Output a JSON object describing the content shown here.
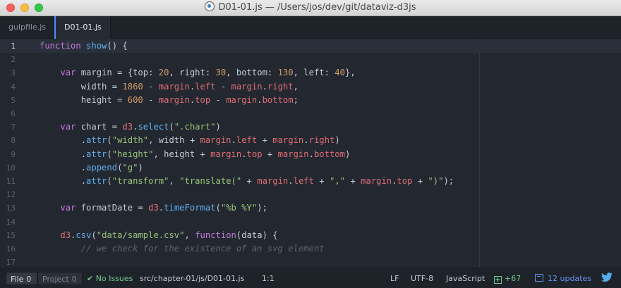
{
  "window": {
    "title": "D01-01.js — /Users/jos/dev/git/dataviz-d3js"
  },
  "tabs": [
    {
      "label": "gulpfile.js",
      "active": false
    },
    {
      "label": "D01-01.js",
      "active": true
    }
  ],
  "editor": {
    "current_line": 1,
    "lines": [
      {
        "num": "1",
        "tokens": [
          [
            "kw",
            "function"
          ],
          [
            "op",
            " "
          ],
          [
            "fn",
            "show"
          ],
          [
            "op",
            "() {"
          ]
        ]
      },
      {
        "num": "2",
        "tokens": []
      },
      {
        "num": "3",
        "tokens": [
          [
            "op",
            "    "
          ],
          [
            "kw",
            "var"
          ],
          [
            "op",
            " margin = {top: "
          ],
          [
            "num",
            "20"
          ],
          [
            "op",
            ", right: "
          ],
          [
            "num",
            "30"
          ],
          [
            "op",
            ", bottom: "
          ],
          [
            "num",
            "130"
          ],
          [
            "op",
            ", left: "
          ],
          [
            "num",
            "40"
          ],
          [
            "op",
            "},"
          ]
        ]
      },
      {
        "num": "4",
        "tokens": [
          [
            "op",
            "        width = "
          ],
          [
            "num",
            "1860"
          ],
          [
            "op",
            " - "
          ],
          [
            "prop",
            "margin"
          ],
          [
            "op",
            "."
          ],
          [
            "prop",
            "left"
          ],
          [
            "op",
            " - "
          ],
          [
            "prop",
            "margin"
          ],
          [
            "op",
            "."
          ],
          [
            "prop",
            "right"
          ],
          [
            "op",
            ","
          ]
        ]
      },
      {
        "num": "5",
        "tokens": [
          [
            "op",
            "        height = "
          ],
          [
            "num",
            "600"
          ],
          [
            "op",
            " - "
          ],
          [
            "prop",
            "margin"
          ],
          [
            "op",
            "."
          ],
          [
            "prop",
            "top"
          ],
          [
            "op",
            " - "
          ],
          [
            "prop",
            "margin"
          ],
          [
            "op",
            "."
          ],
          [
            "prop",
            "bottom"
          ],
          [
            "op",
            ";"
          ]
        ]
      },
      {
        "num": "6",
        "tokens": []
      },
      {
        "num": "7",
        "tokens": [
          [
            "op",
            "    "
          ],
          [
            "kw",
            "var"
          ],
          [
            "op",
            " chart = "
          ],
          [
            "prop",
            "d3"
          ],
          [
            "op",
            "."
          ],
          [
            "fn",
            "select"
          ],
          [
            "op",
            "("
          ],
          [
            "str",
            "\".chart\""
          ],
          [
            "op",
            ")"
          ]
        ]
      },
      {
        "num": "8",
        "tokens": [
          [
            "op",
            "        ."
          ],
          [
            "fn",
            "attr"
          ],
          [
            "op",
            "("
          ],
          [
            "str",
            "\"width\""
          ],
          [
            "op",
            ", width + "
          ],
          [
            "prop",
            "margin"
          ],
          [
            "op",
            "."
          ],
          [
            "prop",
            "left"
          ],
          [
            "op",
            " + "
          ],
          [
            "prop",
            "margin"
          ],
          [
            "op",
            "."
          ],
          [
            "prop",
            "right"
          ],
          [
            "op",
            ")"
          ]
        ]
      },
      {
        "num": "9",
        "tokens": [
          [
            "op",
            "        ."
          ],
          [
            "fn",
            "attr"
          ],
          [
            "op",
            "("
          ],
          [
            "str",
            "\"height\""
          ],
          [
            "op",
            ", height + "
          ],
          [
            "prop",
            "margin"
          ],
          [
            "op",
            "."
          ],
          [
            "prop",
            "top"
          ],
          [
            "op",
            " + "
          ],
          [
            "prop",
            "margin"
          ],
          [
            "op",
            "."
          ],
          [
            "prop",
            "bottom"
          ],
          [
            "op",
            ")"
          ]
        ]
      },
      {
        "num": "10",
        "tokens": [
          [
            "op",
            "        ."
          ],
          [
            "fn",
            "append"
          ],
          [
            "op",
            "("
          ],
          [
            "str",
            "\"g\""
          ],
          [
            "op",
            ")"
          ]
        ]
      },
      {
        "num": "11",
        "tokens": [
          [
            "op",
            "        ."
          ],
          [
            "fn",
            "attr"
          ],
          [
            "op",
            "("
          ],
          [
            "str",
            "\"transform\""
          ],
          [
            "op",
            ", "
          ],
          [
            "str",
            "\"translate(\""
          ],
          [
            "op",
            " + "
          ],
          [
            "prop",
            "margin"
          ],
          [
            "op",
            "."
          ],
          [
            "prop",
            "left"
          ],
          [
            "op",
            " + "
          ],
          [
            "str",
            "\",\""
          ],
          [
            "op",
            " + "
          ],
          [
            "prop",
            "margin"
          ],
          [
            "op",
            "."
          ],
          [
            "prop",
            "top"
          ],
          [
            "op",
            " + "
          ],
          [
            "str",
            "\")\""
          ],
          [
            "op",
            ");"
          ]
        ]
      },
      {
        "num": "12",
        "tokens": []
      },
      {
        "num": "13",
        "tokens": [
          [
            "op",
            "    "
          ],
          [
            "kw",
            "var"
          ],
          [
            "op",
            " formatDate = "
          ],
          [
            "prop",
            "d3"
          ],
          [
            "op",
            "."
          ],
          [
            "fn",
            "timeFormat"
          ],
          [
            "op",
            "("
          ],
          [
            "str",
            "\"%b %Y\""
          ],
          [
            "op",
            ");"
          ]
        ]
      },
      {
        "num": "14",
        "tokens": []
      },
      {
        "num": "15",
        "tokens": [
          [
            "op",
            "    "
          ],
          [
            "prop",
            "d3"
          ],
          [
            "op",
            "."
          ],
          [
            "fn",
            "csv"
          ],
          [
            "op",
            "("
          ],
          [
            "str",
            "\"data/sample.csv\""
          ],
          [
            "op",
            ", "
          ],
          [
            "kw",
            "function"
          ],
          [
            "op",
            "(data) {"
          ]
        ]
      },
      {
        "num": "16",
        "tokens": [
          [
            "cm",
            "        // we check for the existence of an svg element"
          ]
        ]
      },
      {
        "num": "17",
        "tokens": []
      }
    ]
  },
  "statusbar": {
    "file_label": "File",
    "file_count": "0",
    "project_label": "Project",
    "project_count": "0",
    "issues_check": "✔",
    "issues": "No Issues",
    "path": "src/chapter-01/js/D01-01.js",
    "cursor": "1:1",
    "line_ending": "LF",
    "encoding": "UTF-8",
    "grammar": "JavaScript",
    "git_added_icon": "+",
    "git_added": "+67",
    "updates": "12 updates",
    "colors": {
      "green": "#73c990",
      "blue": "#6494ed",
      "accent": "#528bff"
    }
  }
}
